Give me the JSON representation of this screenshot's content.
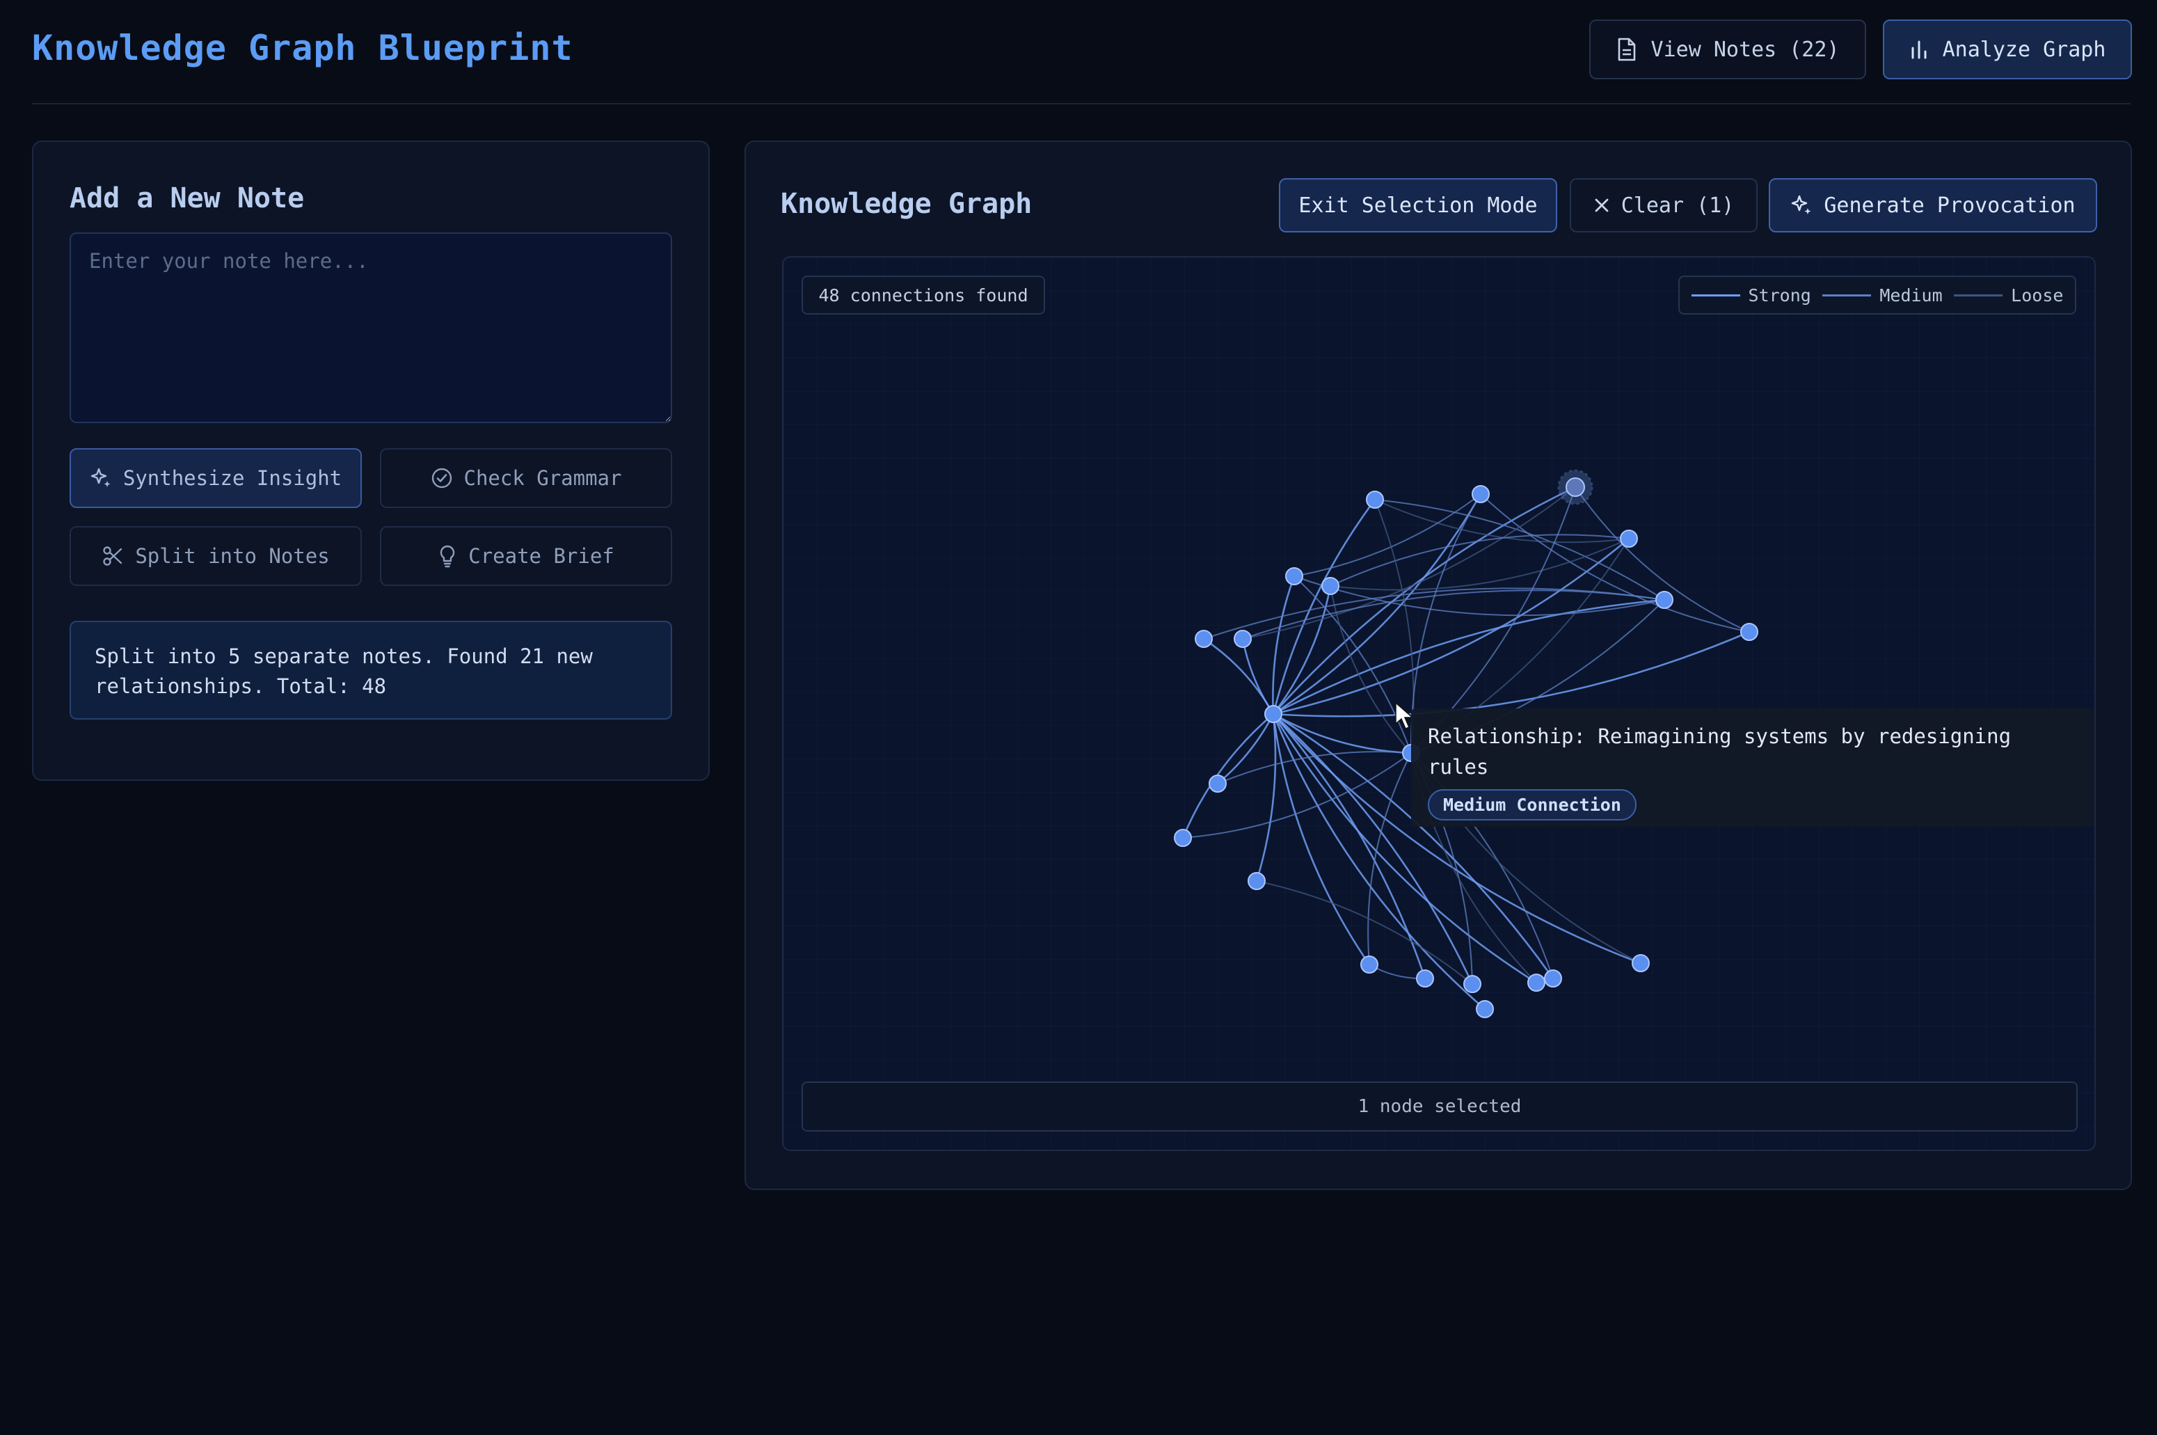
{
  "header": {
    "title": "Knowledge Graph Blueprint",
    "view_notes_label": "View Notes (22)",
    "analyze_label": "Analyze Graph"
  },
  "note_panel": {
    "title": "Add a New Note",
    "input_placeholder": "Enter your note here...",
    "input_value": "",
    "actions": {
      "synthesize": "Synthesize Insight",
      "grammar": "Check Grammar",
      "split": "Split into Notes",
      "brief": "Create Brief"
    },
    "status": "Split into 5 separate notes. Found 21 new relationships. Total: 48"
  },
  "graph_panel": {
    "title": "Knowledge Graph",
    "exit_selection_label": "Exit Selection Mode",
    "clear_label": "Clear (1)",
    "provocation_label": "Generate Provocation",
    "connections_chip": "48 connections found",
    "legend": {
      "strong": "Strong",
      "medium": "Medium",
      "loose": "Loose"
    },
    "tooltip": {
      "text": "Relationship: Reimagining systems by redesigning rules",
      "badge": "Medium Connection"
    },
    "selection_status": "1 node selected",
    "colors": {
      "node": "#5b8ff0",
      "strong": "#6f9ef5",
      "medium": "#5d80c6",
      "loose": "#3f5680",
      "selected": "#5c78b8"
    }
  }
}
